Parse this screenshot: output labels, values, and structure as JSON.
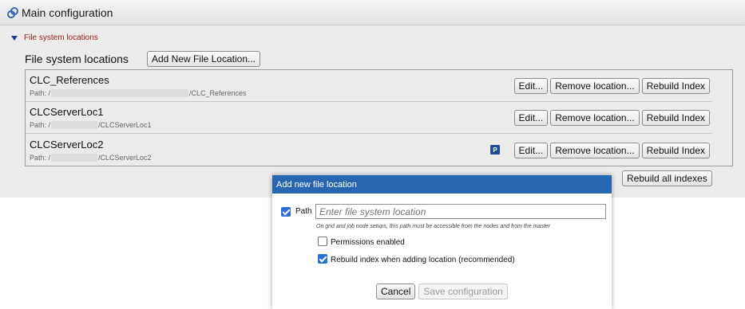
{
  "titlebar": {
    "title": "Main configuration"
  },
  "section": {
    "toggle_label": "File system locations"
  },
  "fs": {
    "heading": "File system locations",
    "add_button": "Add New File Location...",
    "locations": [
      {
        "name": "CLC_References",
        "path_prefix": "Path: /",
        "path_suffix": "/CLC_References",
        "badge": ""
      },
      {
        "name": "CLCServerLoc1",
        "path_prefix": "Path: /",
        "path_suffix": "/CLCServerLoc1",
        "badge": ""
      },
      {
        "name": "CLCServerLoc2",
        "path_prefix": "Path: /",
        "path_suffix": "/CLCServerLoc2",
        "badge": "P"
      }
    ],
    "edit_label": "Edit...",
    "remove_label": "Remove location...",
    "rebuild_label": "Rebuild Index",
    "rebuild_all_label": "Rebuild all indexes"
  },
  "dialog": {
    "title": "Add new file location",
    "path_label": "Path",
    "path_placeholder": "Enter file system location",
    "hint": "On grid and job node setups, this path must be accessible from the nodes and from the master",
    "permissions_label": "Permissions enabled",
    "rebuild_label": "Rebuild index when adding location (recommended)",
    "cancel_label": "Cancel",
    "save_label": "Save configuration",
    "path_checked": true,
    "permissions_checked": false,
    "rebuild_checked": true
  },
  "colors": {
    "accent": "#2766b0",
    "section_red": "#a02020",
    "checkbox_blue": "#2b6fd6"
  }
}
